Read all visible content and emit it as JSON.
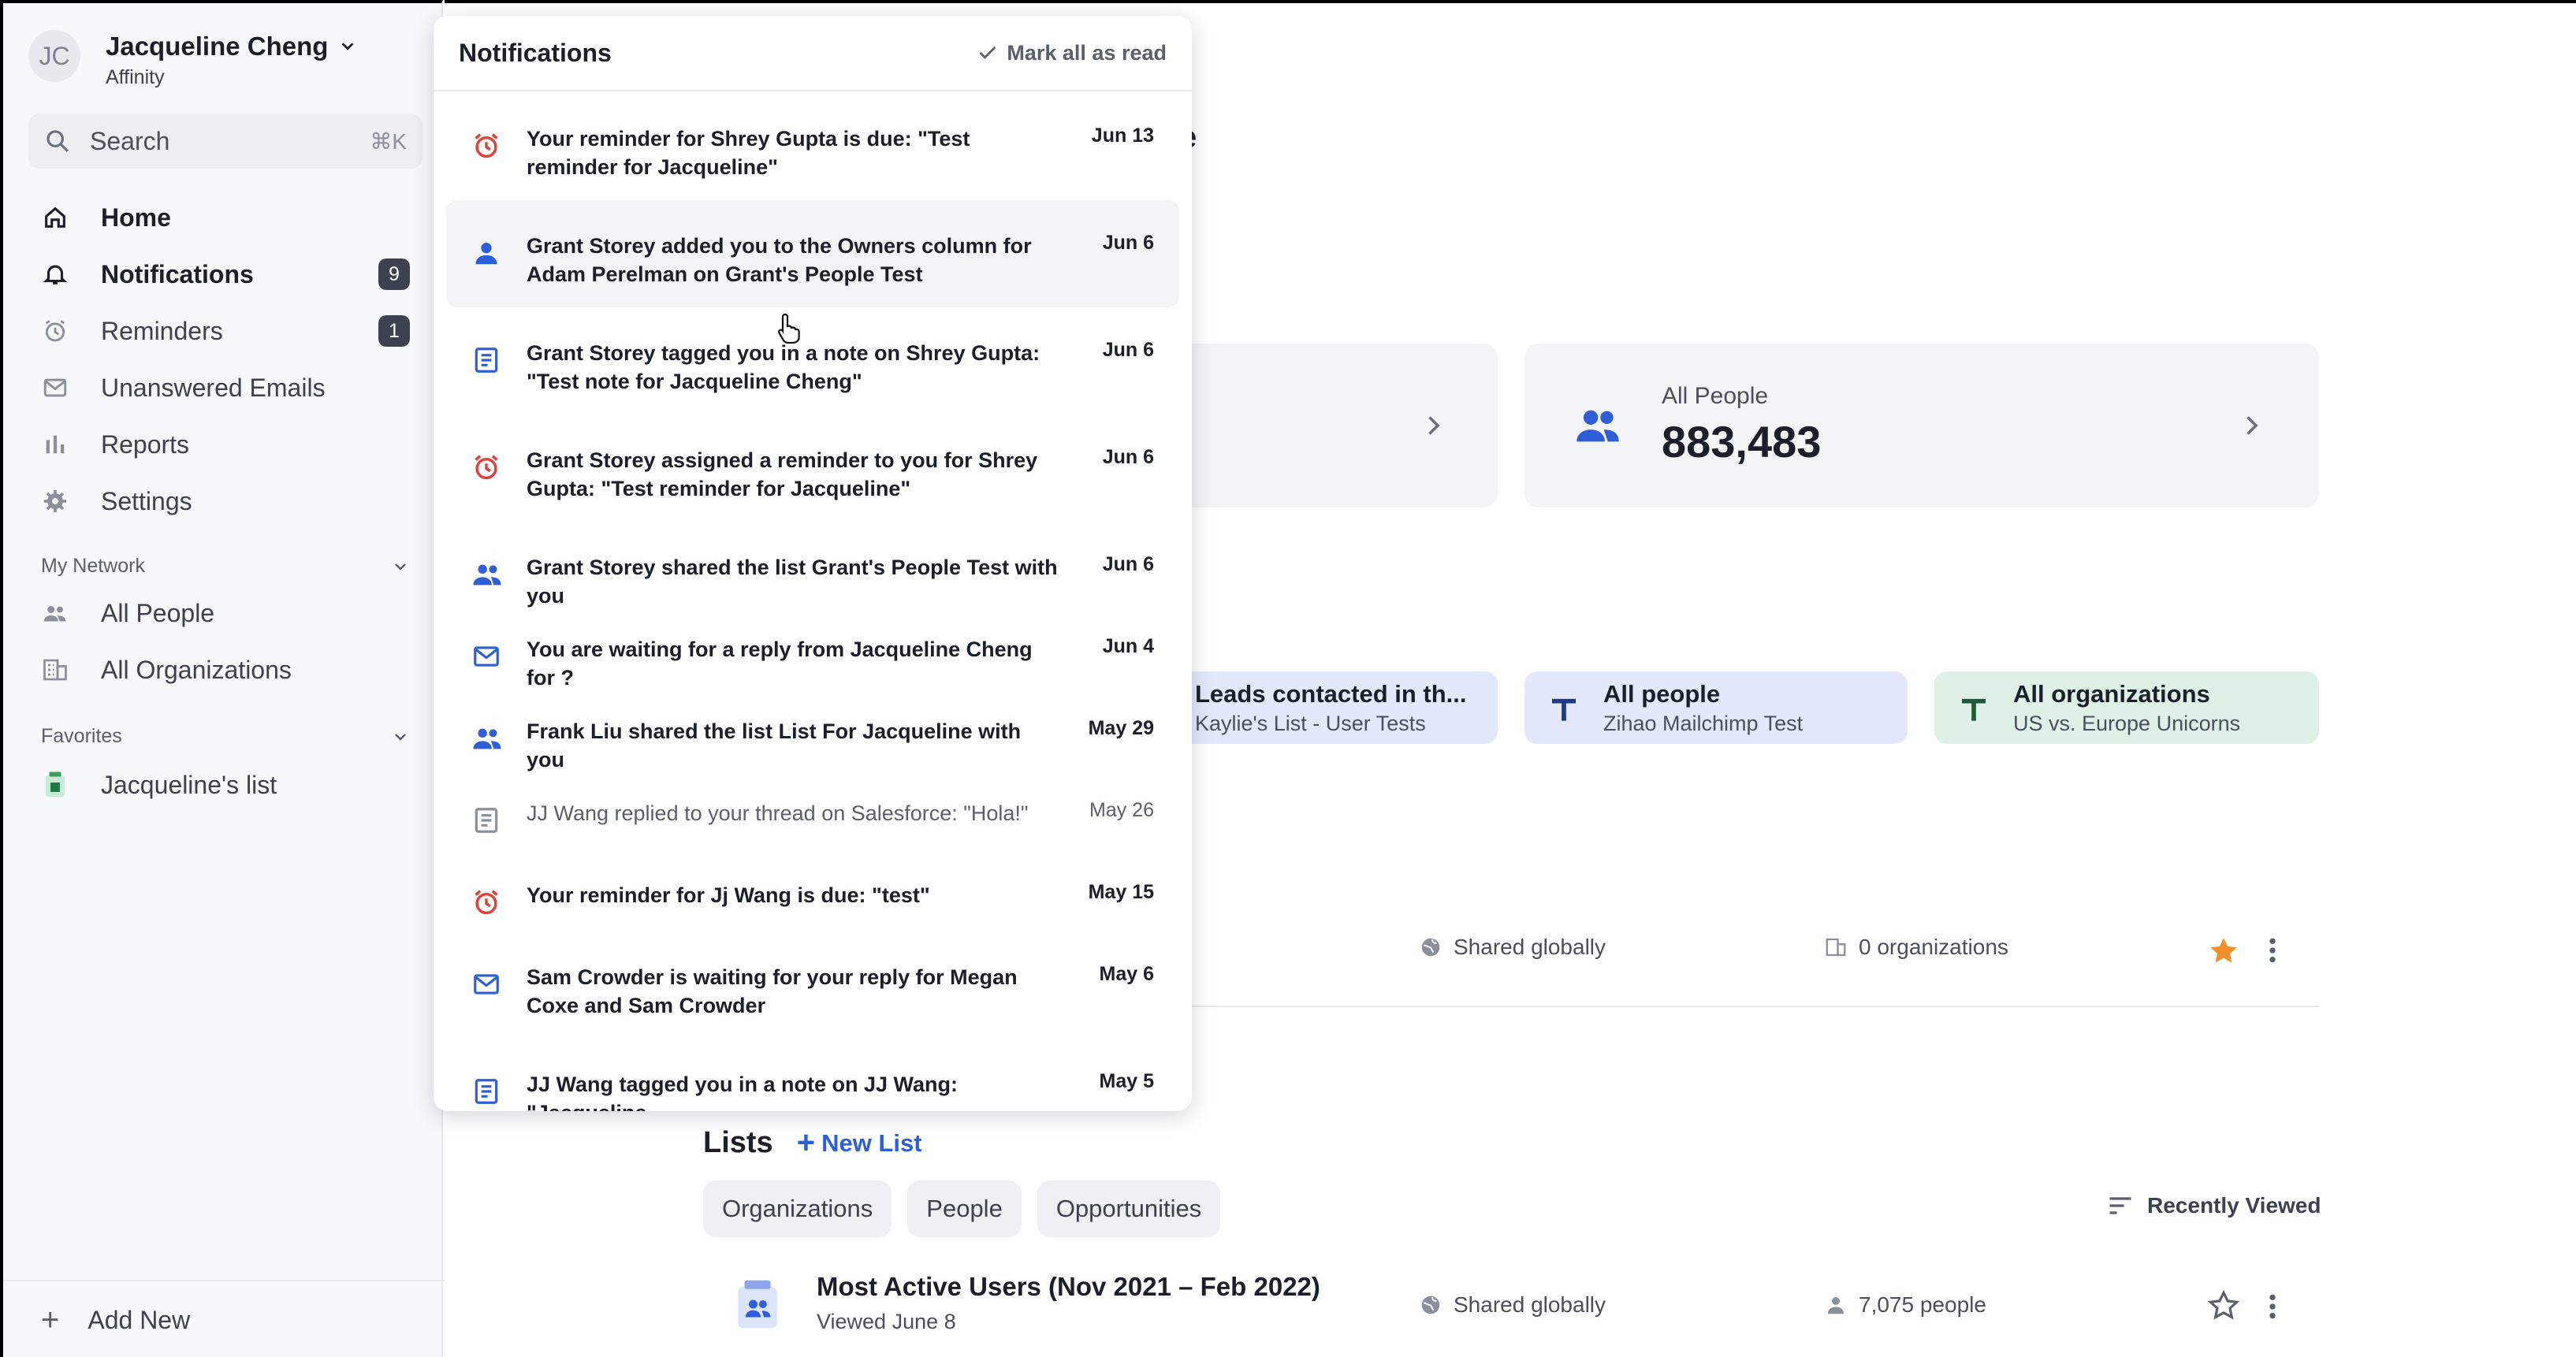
{
  "user": {
    "initials": "JC",
    "name": "Jacqueline Cheng",
    "org": "Affinity"
  },
  "search": {
    "label": "Search",
    "shortcut": "⌘K"
  },
  "nav": [
    {
      "label": "Home",
      "icon": "home-icon"
    },
    {
      "label": "Notifications",
      "icon": "bell-icon",
      "badge": "9"
    },
    {
      "label": "Reminders",
      "icon": "alarm-icon",
      "badge": "1"
    },
    {
      "label": "Unanswered Emails",
      "icon": "mail-icon"
    },
    {
      "label": "Reports",
      "icon": "bar-chart-icon"
    },
    {
      "label": "Settings",
      "icon": "gear-icon"
    }
  ],
  "my_network": {
    "title": "My Network",
    "items": [
      "All People",
      "All Organizations"
    ]
  },
  "favorites": {
    "title": "Favorites",
    "items": [
      "Jacqueline's list"
    ]
  },
  "add_new": "Add New",
  "main": {
    "title_fragment": "e",
    "all_people": {
      "label": "All People",
      "value": "883,483"
    },
    "pins": [
      {
        "title": "Leads contacted in th...",
        "sub": "Kaylie's List - User Tests"
      },
      {
        "title": "All people",
        "sub": "Zihao Mailchimp Test"
      },
      {
        "title": "All organizations",
        "sub": "US vs. Europe Unicorns"
      }
    ],
    "fav_row": {
      "shared": "Shared globally",
      "count": "0 organizations"
    },
    "lists": {
      "title": "Lists",
      "new_list": "New List",
      "tabs": [
        "Organizations",
        "People",
        "Opportunities"
      ],
      "sort": "Recently Viewed",
      "row": {
        "title": "Most Active Users (Nov 2021 – Feb 2022)",
        "viewed": "Viewed June 8",
        "shared": "Shared globally",
        "count": "7,075 people"
      }
    }
  },
  "notifications": {
    "title": "Notifications",
    "mark_all": "Mark all as read",
    "items": [
      {
        "icon": "alarm-icon",
        "text": "Your reminder for Shrey Gupta is due: \"Test reminder for Jacqueline\"",
        "date": "Jun 13",
        "read": false
      },
      {
        "icon": "person-icon",
        "text": "Grant Storey added you to the Owners column for Adam Perelman on Grant's People Test",
        "date": "Jun 6",
        "read": false
      },
      {
        "icon": "note-icon",
        "text": "Grant Storey tagged you in a note on Shrey Gupta: \"Test note for Jacqueline Cheng\"",
        "date": "Jun 6",
        "read": false
      },
      {
        "icon": "alarm-icon",
        "text": "Grant Storey assigned a reminder to you for Shrey Gupta: \"Test reminder for Jacqueline\"",
        "date": "Jun 6",
        "read": false
      },
      {
        "icon": "people-icon",
        "text": "Grant Storey shared the list Grant's People Test with you",
        "date": "Jun 6",
        "read": false
      },
      {
        "icon": "mail-icon",
        "text": "You are waiting for a reply from Jacqueline Cheng for ?",
        "date": "Jun 4",
        "read": false
      },
      {
        "icon": "people-icon",
        "text": "Frank Liu shared the list List For Jacqueline with you",
        "date": "May 29",
        "read": false
      },
      {
        "icon": "note-icon",
        "text": "JJ Wang replied to your thread on Salesforce: \"Hola!\"",
        "date": "May 26",
        "read": true
      },
      {
        "icon": "alarm-icon",
        "text": "Your reminder for Jj Wang is due: \"test\"",
        "date": "May 15",
        "read": false
      },
      {
        "icon": "mail-icon",
        "text": "Sam Crowder is waiting for your reply for Megan Coxe and Sam Crowder",
        "date": "May 6",
        "read": false
      },
      {
        "icon": "note-icon",
        "text": "JJ Wang tagged you in a note on JJ Wang: \"Jacqueline",
        "date": "May 5",
        "read": false
      }
    ]
  },
  "colors": {
    "alarm": "#e0413a",
    "blue": "#2f5fd6",
    "green": "#1f7a4a",
    "badge": "#3d4250"
  }
}
